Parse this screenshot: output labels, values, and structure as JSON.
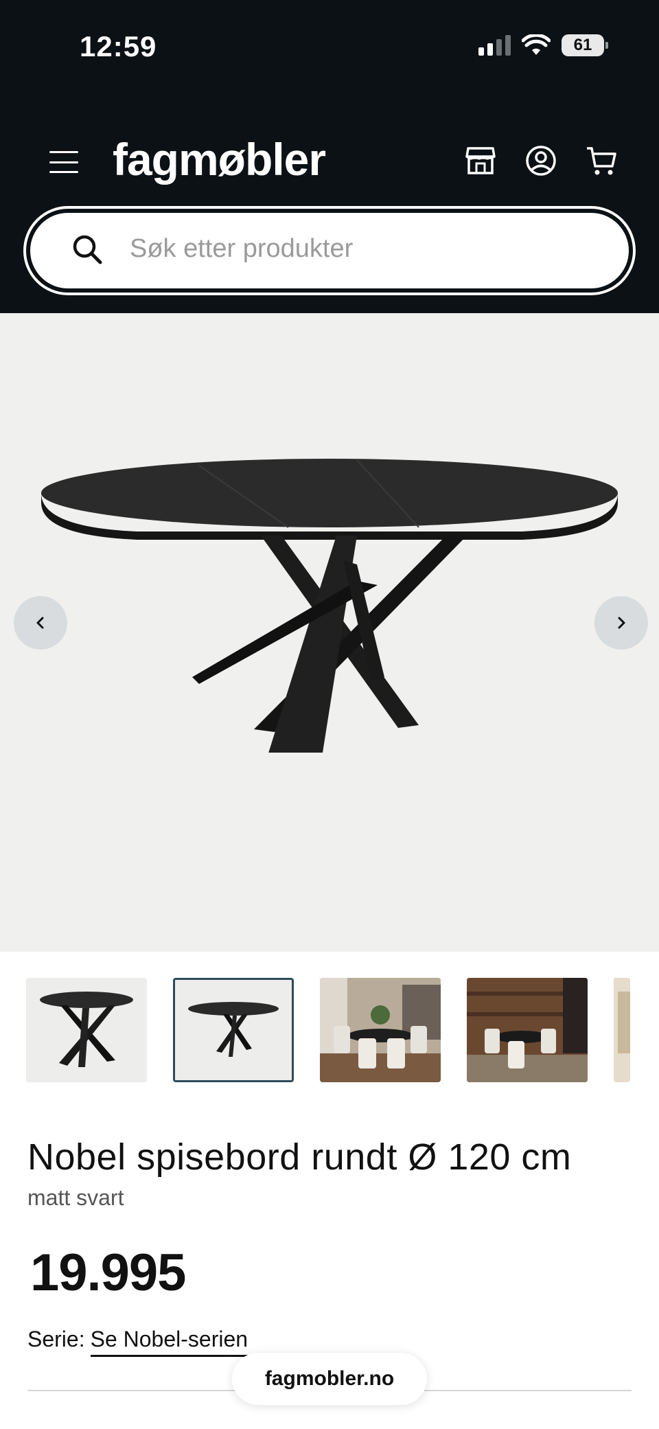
{
  "status_bar": {
    "time": "12:59",
    "battery": "61"
  },
  "header": {
    "logo": "fagmøbler",
    "search_placeholder": "Søk etter produkter"
  },
  "icons": [
    "menu-icon",
    "store-icon",
    "account-icon",
    "cart-icon",
    "search-icon",
    "chevron-left-icon",
    "chevron-right-icon"
  ],
  "product": {
    "title": "Nobel spisebord rundt Ø 120 cm",
    "subtitle": "matt svart",
    "price": "19.995",
    "series_label": "Serie:",
    "series_link": "Se Nobel-serien"
  },
  "browser": {
    "url": "fagmobler.no"
  },
  "colors": {
    "header_bg": "#0b1114",
    "hero_bg": "#f0f0ee",
    "active_thumb_border": "#2f4a5a"
  }
}
